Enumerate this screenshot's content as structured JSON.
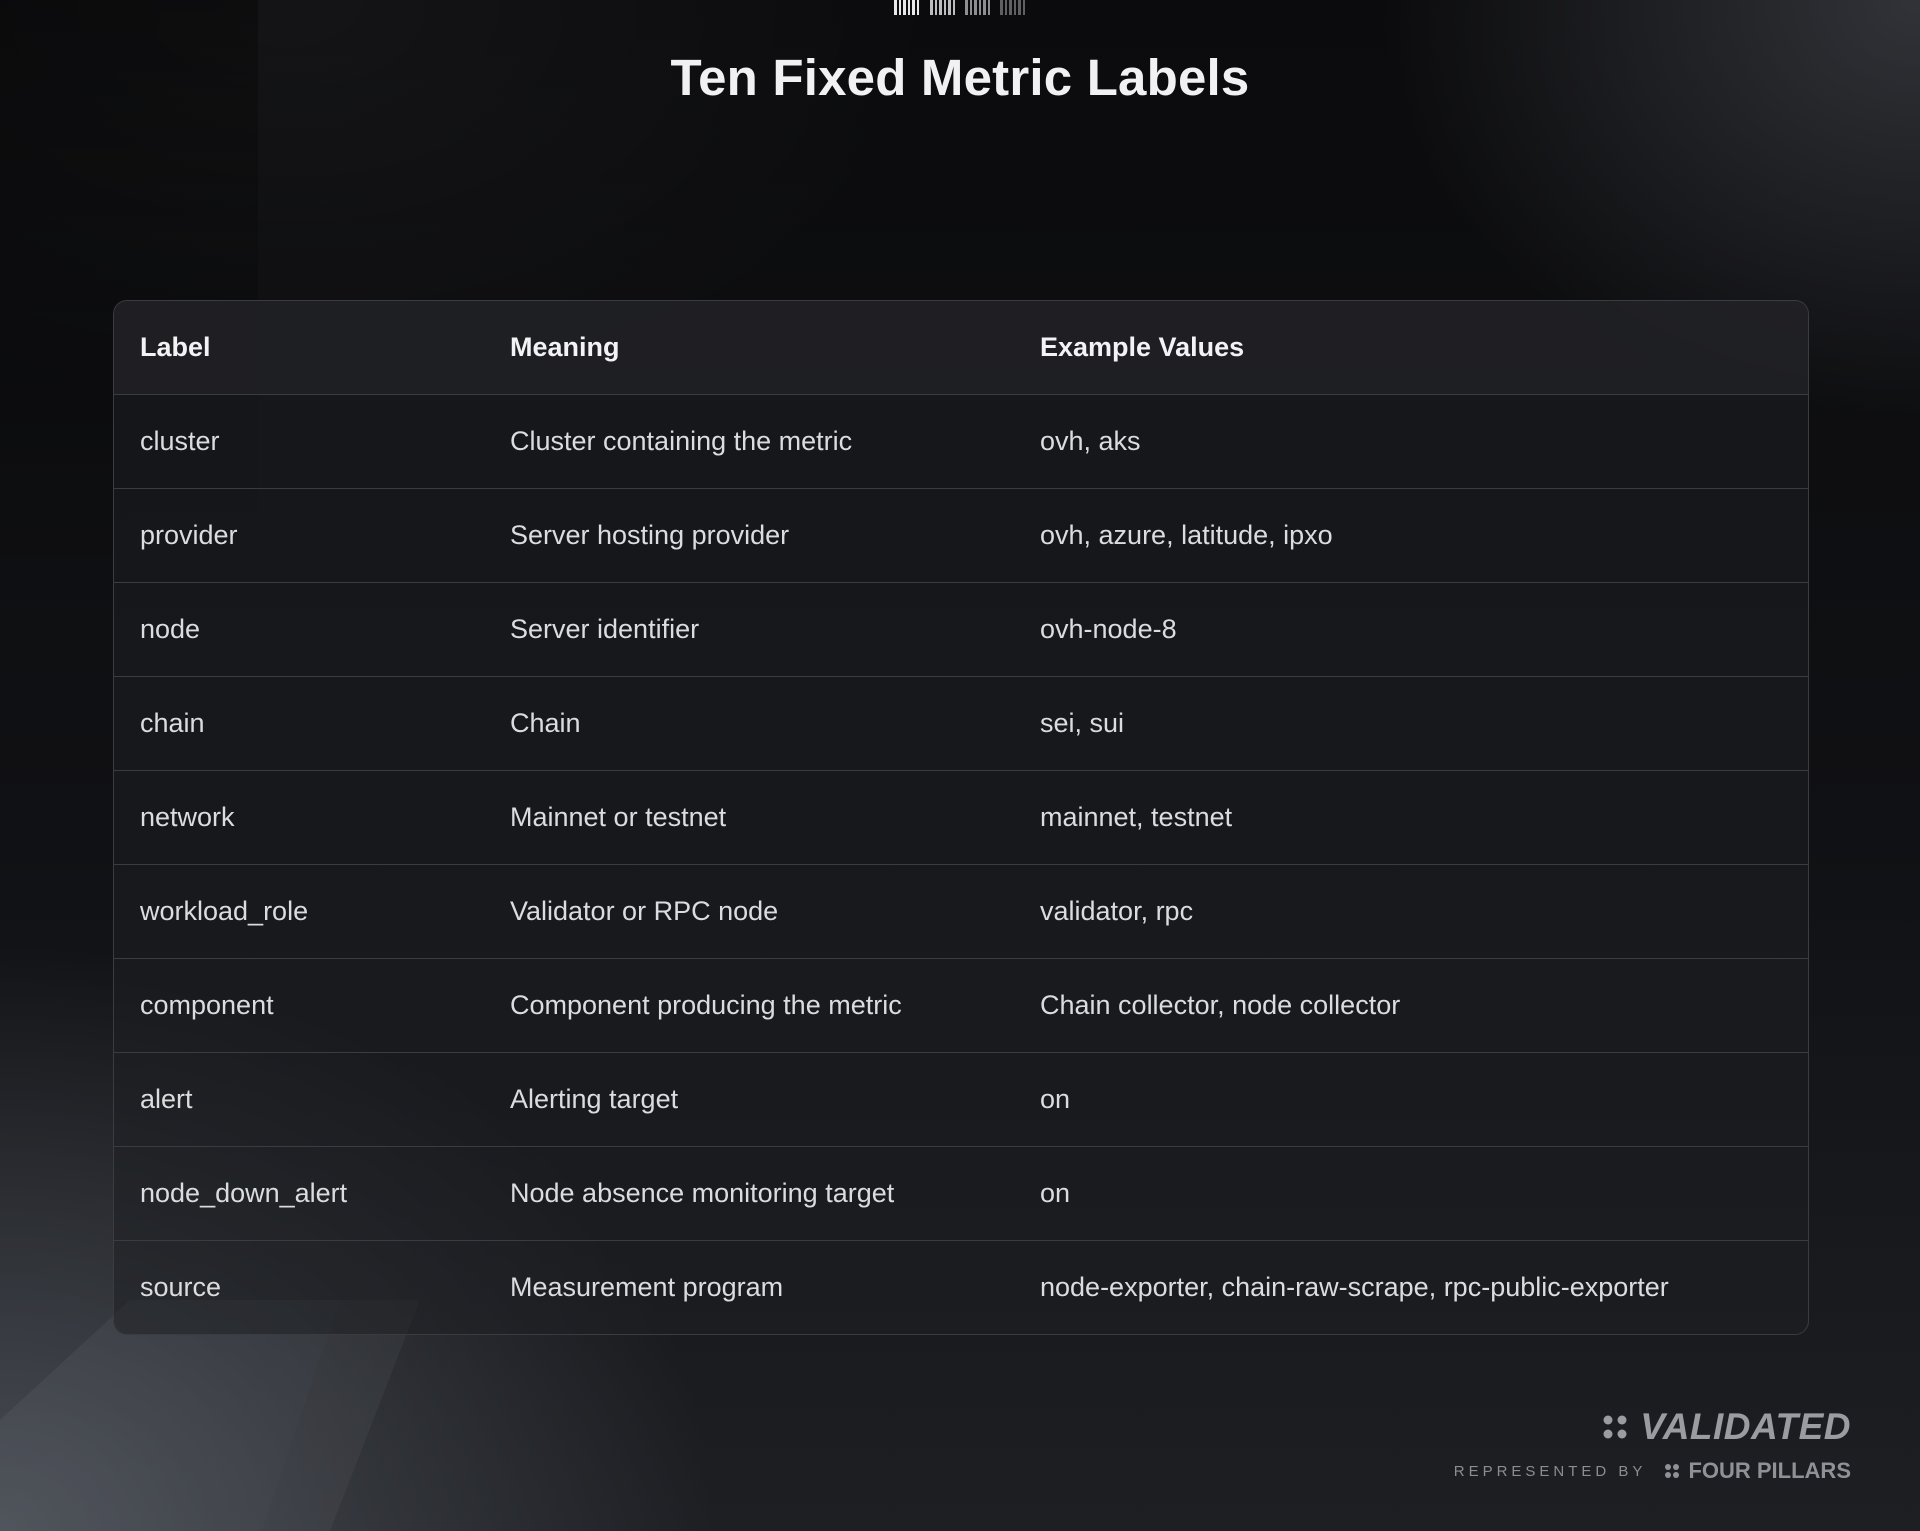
{
  "title": "Ten Fixed Metric Labels",
  "table": {
    "headers": [
      "Label",
      "Meaning",
      "Example Values"
    ],
    "rows": [
      [
        "cluster",
        "Cluster containing the metric",
        "ovh, aks"
      ],
      [
        "provider",
        "Server hosting provider",
        "ovh, azure, latitude, ipxo"
      ],
      [
        "node",
        "Server identifier",
        "ovh-node-8"
      ],
      [
        "chain",
        "Chain",
        "sei, sui"
      ],
      [
        "network",
        "Mainnet or testnet",
        "mainnet, testnet"
      ],
      [
        "workload_role",
        "Validator or RPC node",
        "validator, rpc"
      ],
      [
        "component",
        "Component producing the metric",
        "Chain collector, node collector"
      ],
      [
        "alert",
        "Alerting target",
        "on"
      ],
      [
        "node_down_alert",
        "Node absence monitoring target",
        "on"
      ],
      [
        "source",
        "Measurement program",
        "node-exporter, chain-raw-scrape, rpc-public-exporter"
      ]
    ]
  },
  "brand": {
    "name": "VALIDATED",
    "represented_by": "REPRESENTED BY",
    "partner": "FOUR PILLARS",
    "logo_icon": "four-dots-icon"
  },
  "colors": {
    "background": "#0b0b0d",
    "table_border": "#3a3c41",
    "text": "#dcdcdf",
    "brand": "#9a9ca2"
  }
}
